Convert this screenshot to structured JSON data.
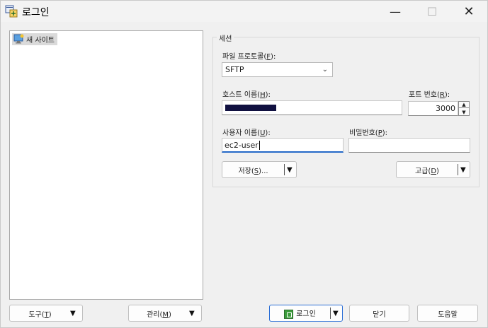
{
  "window": {
    "title": "로그인",
    "minimize": "—",
    "maximize": "☐",
    "close": "✕"
  },
  "tree": {
    "items": [
      {
        "label": "새 사이트",
        "icon": "new-site-icon"
      }
    ]
  },
  "session": {
    "group_label": "세션",
    "protocol_label": "파일 프로토콜(",
    "protocol_key": "F",
    "protocol_value": "SFTP",
    "host_label": "호스트 이름(",
    "host_key": "H",
    "host_value": "",
    "port_label": "포트 번호(",
    "port_key": "R",
    "port_value": "3000",
    "user_label": "사용자 이름(",
    "user_key": "U",
    "user_value": "ec2-user",
    "password_label": "비밀번호(",
    "password_key": "P",
    "password_value": "",
    "save_button_pre": "저장(",
    "save_button_key": "S",
    "save_button_post": ")...",
    "advanced_button_pre": "고급(",
    "advanced_button_key": "D",
    "advanced_button_post": ")"
  },
  "footer": {
    "tools_pre": "도구(",
    "tools_key": "T",
    "tools_post": ")",
    "manage_pre": "관리(",
    "manage_key": "M",
    "manage_post": ")",
    "login": "로그인",
    "close": "닫기",
    "help": "도움말"
  },
  "colors": {
    "accent": "#2468c8",
    "primary_border": "#2b6fd6",
    "login_icon": "#3c9c3c"
  }
}
